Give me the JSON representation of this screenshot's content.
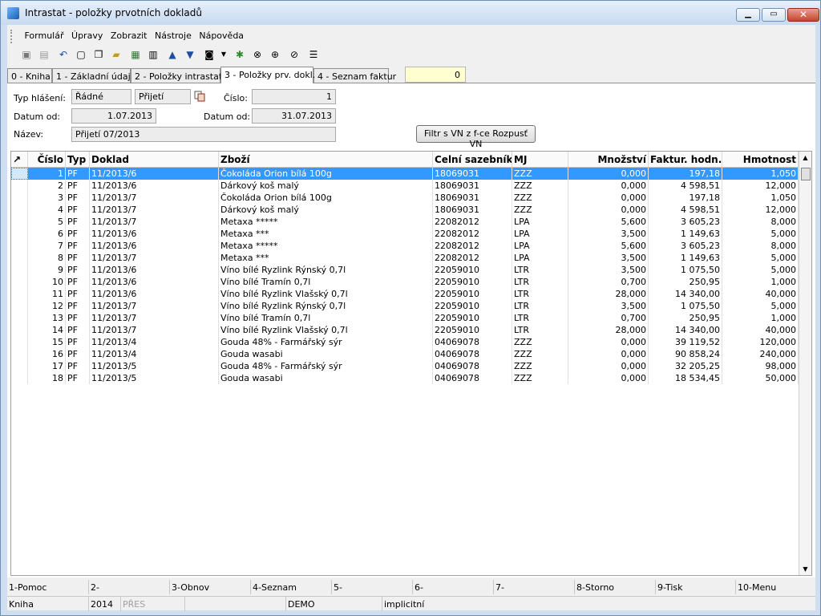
{
  "window": {
    "title": "Intrastat - položky prvotních dokladů"
  },
  "menu": [
    "Formulář",
    "Úpravy",
    "Zobrazit",
    "Nástroje",
    "Nápověda"
  ],
  "tabs": [
    "0 - Kniha",
    "1 - Základní údaje",
    "2 - Položky intrastatu",
    "3 - Položky prv. dokl.",
    "4 - Seznam faktur"
  ],
  "active_tab": "3 - Položky prv. dokl.",
  "counter_value": "0",
  "form": {
    "typ_label": "Typ hlášení:",
    "typ_value": "Řádné",
    "smer_value": "Přijetí",
    "cislo_label": "Číslo:",
    "cislo_value": "1",
    "datum_od_label": "Datum od:",
    "datum_od_value": "1.07.2013",
    "datum_do_label": "Datum od:",
    "datum_do_value": "31.07.2013",
    "nazev_label": "Název:",
    "nazev_value": "Přijetí 07/2013",
    "filter_button": "Filtr s VN z f-ce Rozpusť VN"
  },
  "grid": {
    "columns": [
      "Číslo",
      "Typ",
      "Doklad",
      "Zboží",
      "Celní sazebník",
      "MJ",
      "Množství",
      "Faktur. hodn.",
      "Hmotnost"
    ],
    "sort_indicator": "↗",
    "rows": [
      [
        "1",
        "PF",
        "11/2013/6",
        "Čokoláda Orion bílá 100g",
        "18069031",
        "ZZZ",
        "0,000",
        "197,18",
        "1,050"
      ],
      [
        "2",
        "PF",
        "11/2013/6",
        "Dárkový koš malý",
        "18069031",
        "ZZZ",
        "0,000",
        "4 598,51",
        "12,000"
      ],
      [
        "3",
        "PF",
        "11/2013/7",
        "Čokoláda Orion bílá 100g",
        "18069031",
        "ZZZ",
        "0,000",
        "197,18",
        "1,050"
      ],
      [
        "4",
        "PF",
        "11/2013/7",
        "Dárkový koš malý",
        "18069031",
        "ZZZ",
        "0,000",
        "4 598,51",
        "12,000"
      ],
      [
        "5",
        "PF",
        "11/2013/7",
        "Metaxa *****",
        "22082012",
        "LPA",
        "5,600",
        "3 605,23",
        "8,000"
      ],
      [
        "6",
        "PF",
        "11/2013/6",
        "Metaxa ***",
        "22082012",
        "LPA",
        "3,500",
        "1 149,63",
        "5,000"
      ],
      [
        "7",
        "PF",
        "11/2013/6",
        "Metaxa *****",
        "22082012",
        "LPA",
        "5,600",
        "3 605,23",
        "8,000"
      ],
      [
        "8",
        "PF",
        "11/2013/7",
        "Metaxa ***",
        "22082012",
        "LPA",
        "3,500",
        "1 149,63",
        "5,000"
      ],
      [
        "9",
        "PF",
        "11/2013/6",
        "Víno bílé Ryzlink Rýnský 0,7l",
        "22059010",
        "LTR",
        "3,500",
        "1 075,50",
        "5,000"
      ],
      [
        "10",
        "PF",
        "11/2013/6",
        "Víno bílé Tramín 0,7l",
        "22059010",
        "LTR",
        "0,700",
        "250,95",
        "1,000"
      ],
      [
        "11",
        "PF",
        "11/2013/6",
        "Víno bílé Ryzlink Vlašský 0,7l",
        "22059010",
        "LTR",
        "28,000",
        "14 340,00",
        "40,000"
      ],
      [
        "12",
        "PF",
        "11/2013/7",
        "Víno bílé Ryzlink Rýnský 0,7l",
        "22059010",
        "LTR",
        "3,500",
        "1 075,50",
        "5,000"
      ],
      [
        "13",
        "PF",
        "11/2013/7",
        "Víno bílé Tramín 0,7l",
        "22059010",
        "LTR",
        "0,700",
        "250,95",
        "1,000"
      ],
      [
        "14",
        "PF",
        "11/2013/7",
        "Víno bílé Ryzlink Vlašský 0,7l",
        "22059010",
        "LTR",
        "28,000",
        "14 340,00",
        "40,000"
      ],
      [
        "15",
        "PF",
        "11/2013/4",
        "Gouda 48% - Farmářský sýr",
        "04069078",
        "ZZZ",
        "0,000",
        "39 119,52",
        "120,000"
      ],
      [
        "16",
        "PF",
        "11/2013/4",
        "Gouda wasabi",
        "04069078",
        "ZZZ",
        "0,000",
        "90 858,24",
        "240,000"
      ],
      [
        "17",
        "PF",
        "11/2013/5",
        "Gouda 48% - Farmářský sýr",
        "04069078",
        "ZZZ",
        "0,000",
        "32 205,25",
        "98,000"
      ],
      [
        "18",
        "PF",
        "11/2013/5",
        "Gouda wasabi",
        "04069078",
        "ZZZ",
        "0,000",
        "18 534,45",
        "50,000"
      ]
    ]
  },
  "fkeys": [
    "1-Pomoc",
    "2-",
    "3-Obnov",
    "4-Seznam",
    "5-",
    "6-",
    "7-",
    "8-Storno",
    "9-Tisk",
    "10-Menu"
  ],
  "status": [
    "Kniha",
    "2014",
    "PŘES",
    "",
    "DEMO",
    "implicitní"
  ],
  "colors": {
    "selection": "#3399ff",
    "counter_bg": "#ffffd0"
  }
}
